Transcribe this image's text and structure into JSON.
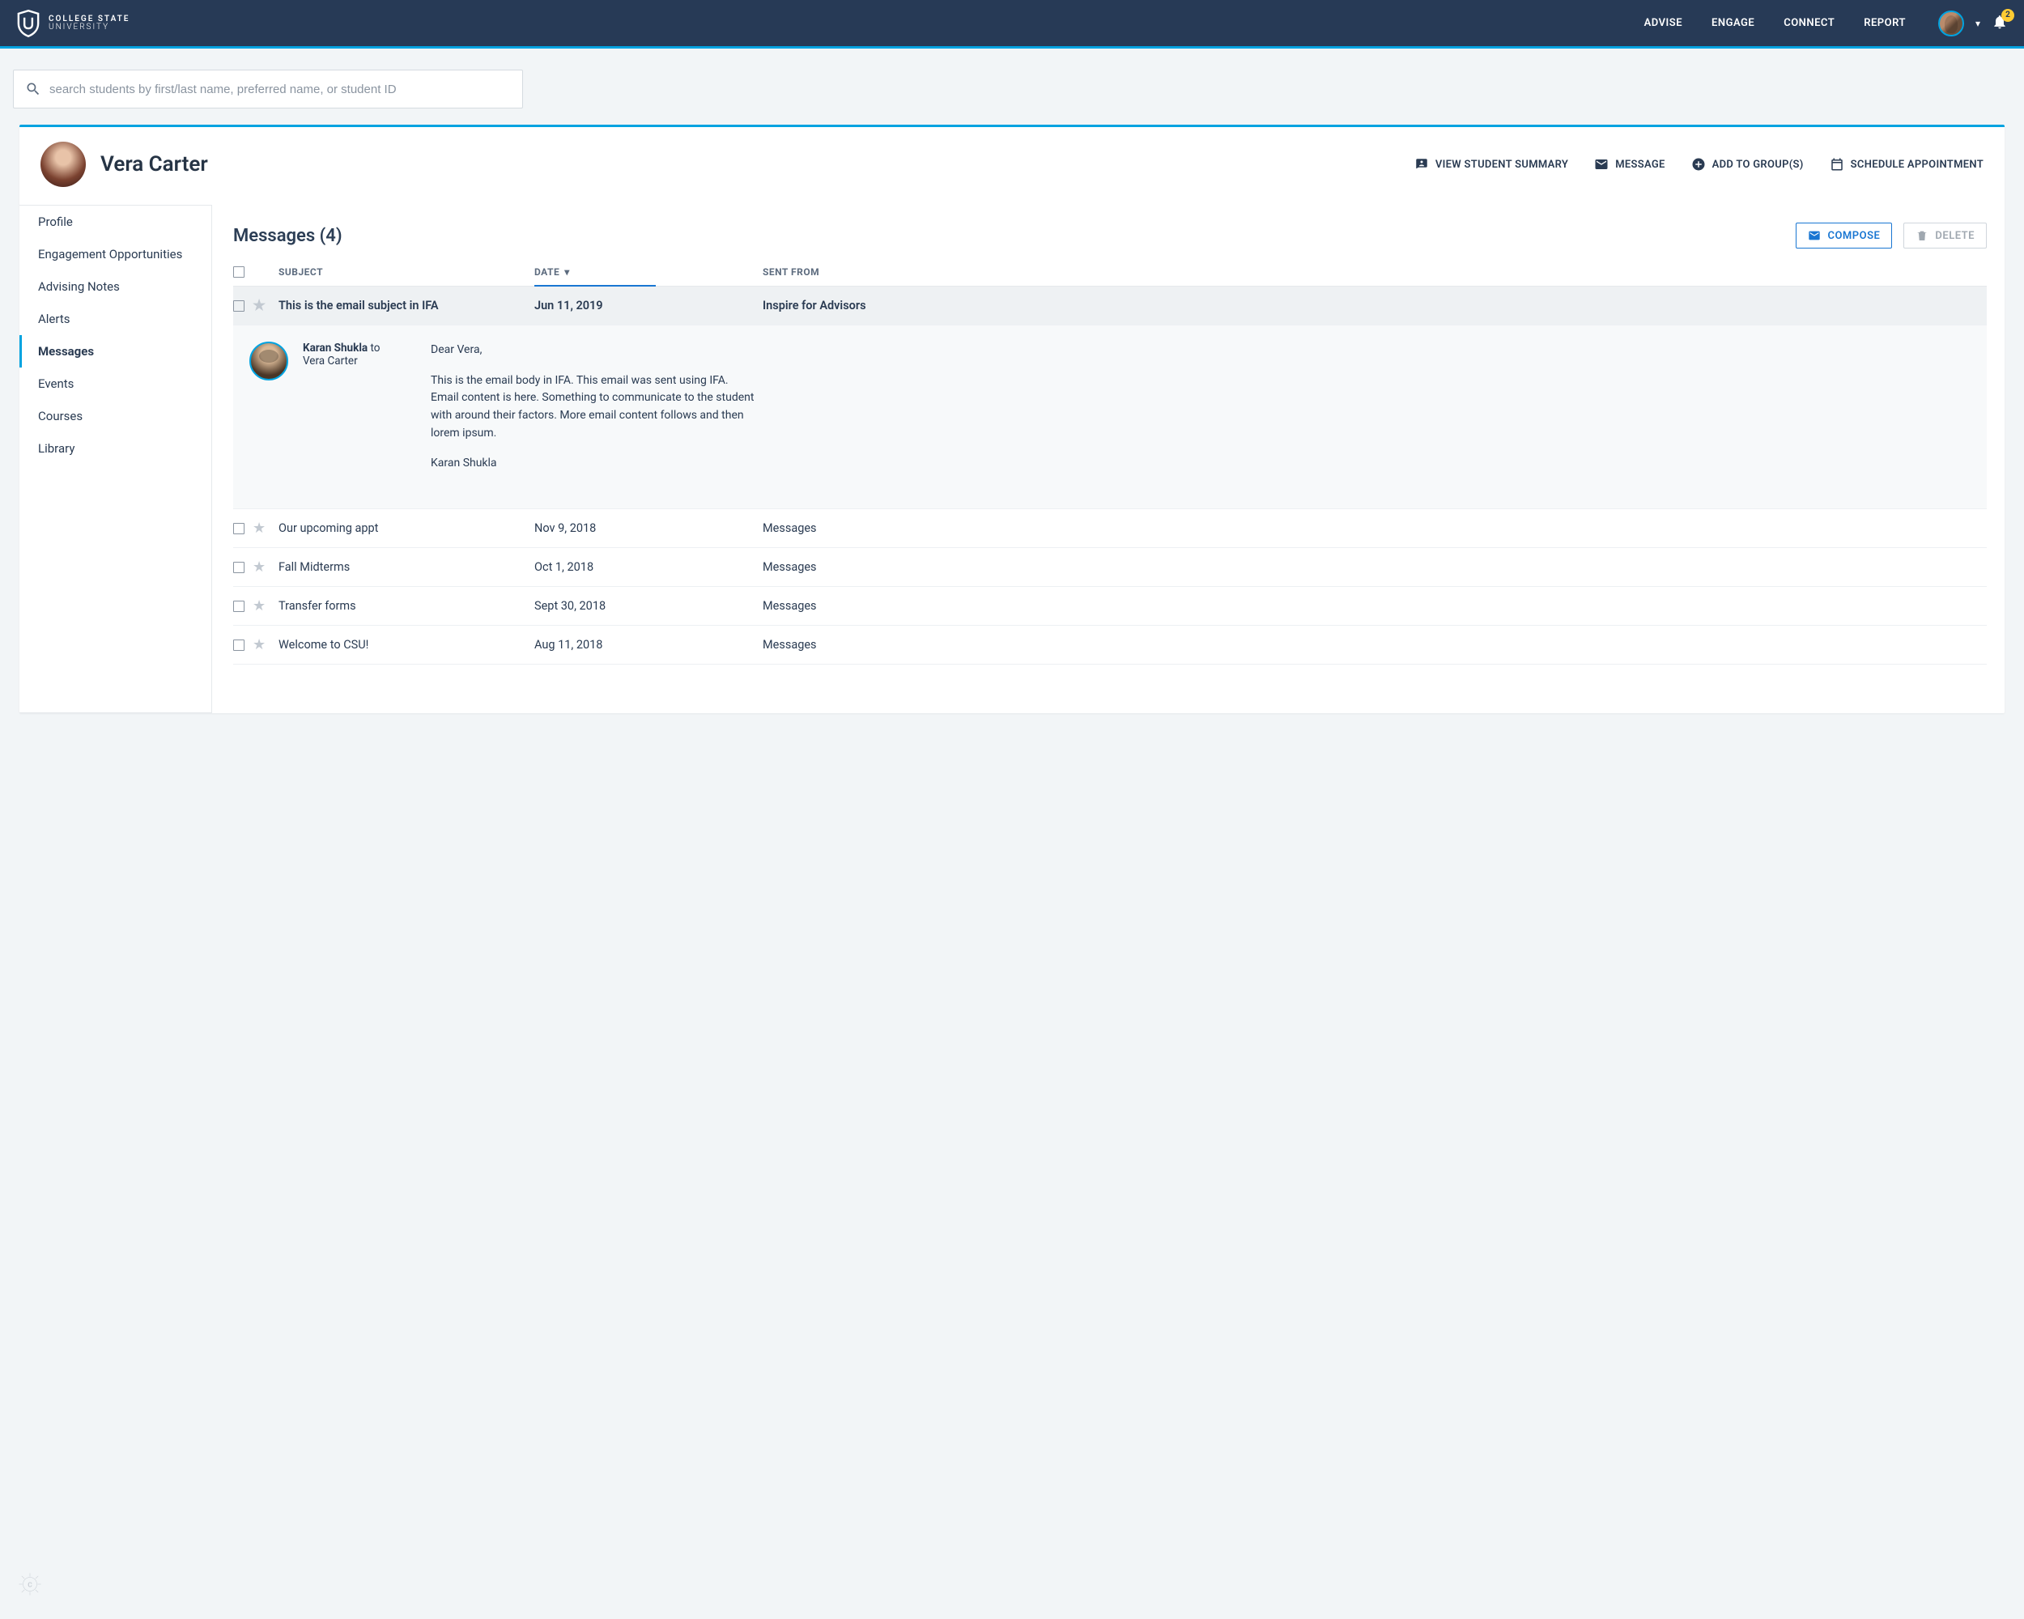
{
  "brand": {
    "line1": "COLLEGE STATE",
    "line2": "UNIVERSITY"
  },
  "nav": {
    "advise": "ADVISE",
    "engage": "ENGAGE",
    "connect": "CONNECT",
    "report": "REPORT"
  },
  "notification_count": "2",
  "search": {
    "placeholder": "search students by first/last name, preferred name, or student ID"
  },
  "student": {
    "name": "Vera Carter"
  },
  "header_actions": {
    "summary": "VIEW STUDENT SUMMARY",
    "message": "MESSAGE",
    "group": "ADD TO GROUP(S)",
    "schedule": "SCHEDULE APPOINTMENT"
  },
  "sidebar": {
    "items": [
      {
        "label": "Profile"
      },
      {
        "label": "Engagement Opportunities"
      },
      {
        "label": "Advising Notes"
      },
      {
        "label": "Alerts"
      },
      {
        "label": "Messages",
        "active": true
      },
      {
        "label": "Events"
      },
      {
        "label": "Courses"
      },
      {
        "label": "Library"
      }
    ]
  },
  "messages_title": "Messages (4)",
  "buttons": {
    "compose": "COMPOSE",
    "delete": "DELETE"
  },
  "columns": {
    "subject": "SUBJECT",
    "date": "DATE",
    "from": "SENT FROM"
  },
  "rows": [
    {
      "subject": "This is the email subject in IFA",
      "date": "Jun 11, 2019",
      "from": "Inspire for Advisors",
      "selected": true,
      "expanded": true
    },
    {
      "subject": "Our upcoming appt",
      "date": "Nov 9, 2018",
      "from": "Messages"
    },
    {
      "subject": "Fall Midterms",
      "date": "Oct 1, 2018",
      "from": "Messages"
    },
    {
      "subject": "Transfer forms",
      "date": "Sept 30, 2018",
      "from": "Messages"
    },
    {
      "subject": "Welcome to CSU!",
      "date": "Aug 11, 2018",
      "from": "Messages"
    }
  ],
  "expanded": {
    "from_name": "Karan Shukla",
    "to_word": "to",
    "to_name": "Vera Carter",
    "greeting": "Dear Vera,",
    "body": "This is the email body in IFA. This email was sent using IFA. Email content is here. Something to communicate to the student with around their factors. More email content follows and then lorem ipsum.",
    "signature": "Karan Shukla"
  }
}
